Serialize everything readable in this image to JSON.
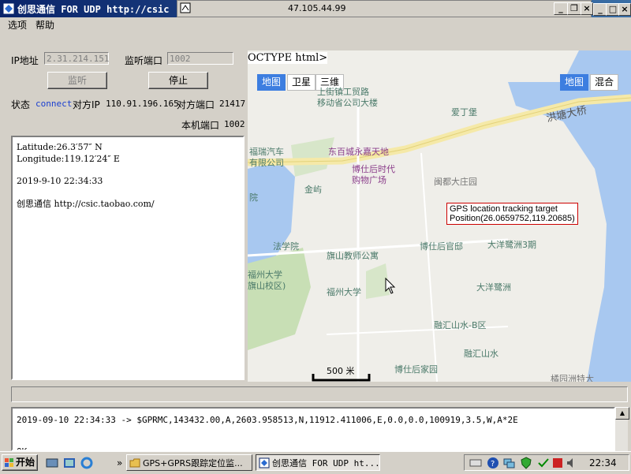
{
  "window": {
    "title": "创思通信 FOR UDP http://csic",
    "inner_address": "47.105.44.99"
  },
  "menu": {
    "options": "选项",
    "help": "帮助"
  },
  "form": {
    "ip_label": "IP地址",
    "ip_value": "2.31.214.151",
    "port_label": "监听端口",
    "port_value": "1002",
    "listen_button": "监听",
    "stop_button": "停止",
    "status_label": "状态",
    "status_value": "connect",
    "peer_ip_label": "对方IP",
    "peer_ip_value": "110.91.196.165",
    "peer_port_label": "对方端口",
    "peer_port_value": "21417",
    "local_port_label": "本机端口",
    "local_port_value": "1002"
  },
  "info_box": {
    "latitude": "Latitude:26.3′57″ N",
    "longitude": "Longitude:119.12′24″ E",
    "datetime": "2019-9-10 22:34:33",
    "promo": "创思通信 http://csic.taobao.com/"
  },
  "map": {
    "doctype_text": "OCTYPE html>",
    "tabs_left": [
      "地图",
      "卫星",
      "三维"
    ],
    "tabs_right": [
      "地图",
      "混合"
    ],
    "road_label": "洪塘大桥",
    "pois": [
      "上街镇工贸路",
      "移动省公司大楼",
      "爱丁堡",
      "福瑞汽车",
      "有限公司",
      "东百城永嘉天地",
      "博仕后时代",
      "购物广场",
      "金屿",
      "闽都大庄园",
      "院",
      "法学院",
      "旗山教师公寓",
      "博仕后官邸",
      "大洋鹭洲3期",
      "福州大学",
      "旗山校区)",
      "福州大学",
      "大洋鹭洲",
      "融汇山水-B区",
      "融汇山水",
      "博仕后家园",
      "橘园洲特大"
    ],
    "tooltip_line1": "GPS location tracking target",
    "tooltip_line2": "Position(26.0659752,119.20685)",
    "scale": "500 米",
    "colors": {
      "water": "#a8c8f0",
      "green": "#c8dfb5",
      "road": "#f5e9a8"
    }
  },
  "log": {
    "line1": "2019-09-10 22:34:33 -> $GPRMC,143432.00,A,2603.958513,N,11912.411006,E,0.0,0.0,100919,3.5,W,A*2E",
    "line2": "OK"
  },
  "taskbar": {
    "start": "开始",
    "task1": "GPS+GPRS跟踪定位监...",
    "task2": "创思通信 FOR UDP ht...",
    "clock": "22:34",
    "more": "»"
  }
}
